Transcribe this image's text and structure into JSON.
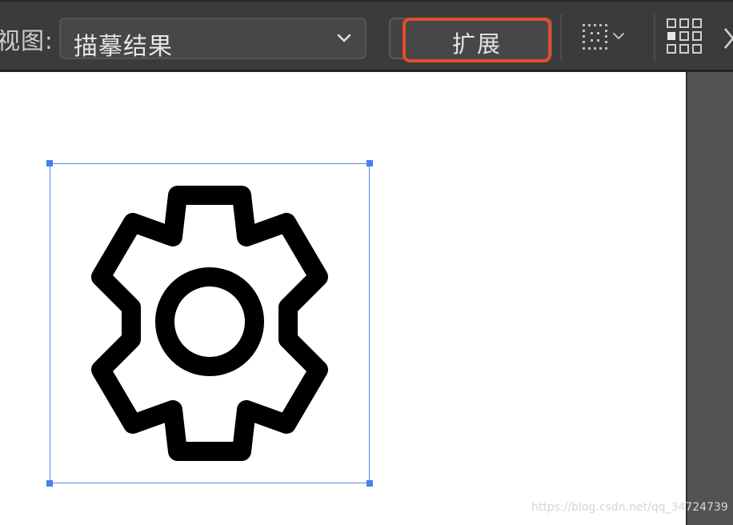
{
  "toolbar": {
    "view_label": "视图:",
    "view_value": "描摹结果",
    "expand_label": "扩展"
  },
  "icons": {
    "dropdown": "chevron-down-icon",
    "grid_tool": "dotted-grid-icon",
    "layout_tool": "grid-layout-icon",
    "close": "close-icon",
    "canvas_object": "gear-icon"
  },
  "colors": {
    "accent_highlight": "#e24e2b",
    "selection": "#4b7ff0",
    "toolbar_bg": "#3b3b3b"
  },
  "watermark": "https://blog.csdn.net/qq_34724739"
}
